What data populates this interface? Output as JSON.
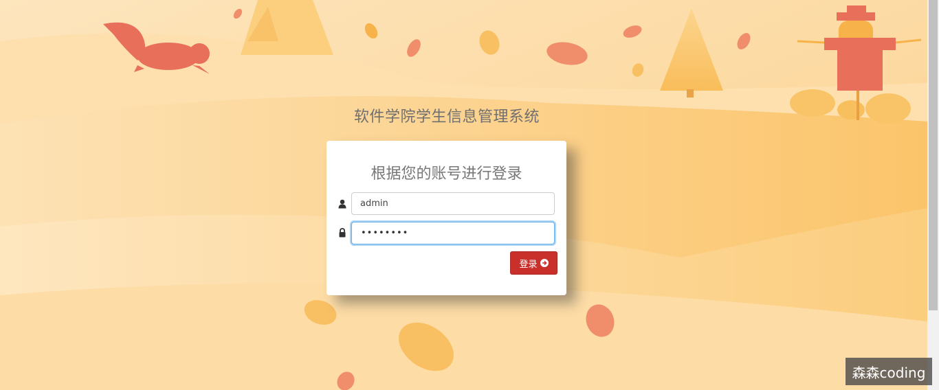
{
  "page": {
    "system_title": "软件学院学生信息管理系统"
  },
  "login": {
    "heading": "根据您的账号进行登录",
    "username_value": "admin",
    "password_mask": "••••••••",
    "button_label": "登录"
  },
  "watermark": {
    "text": "森森coding"
  },
  "icons": {
    "username": "user-icon",
    "password": "lock-icon",
    "button": "arrow-circle-right-icon"
  },
  "colors": {
    "primary_button": "#c9302c",
    "background": "#fcd99a",
    "accent_red": "#e8705a"
  }
}
